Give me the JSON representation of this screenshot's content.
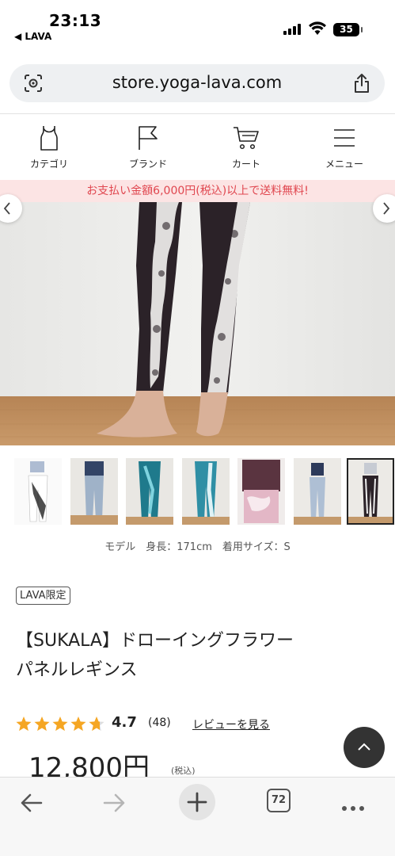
{
  "status": {
    "time": "23:13",
    "back_app": "◀ LAVA",
    "battery": "35"
  },
  "browser": {
    "url": "store.yoga-lava.com",
    "tab_count": "72"
  },
  "nav": {
    "items": [
      {
        "label": "カテゴリ",
        "icon": "tanktop-icon"
      },
      {
        "label": "ブランド",
        "icon": "flag-icon"
      },
      {
        "label": "カート",
        "icon": "cart-icon"
      },
      {
        "label": "メニュー",
        "icon": "hamburger-icon"
      }
    ]
  },
  "banner": "お支払い金額6,000円(税込)以上で送料無料!",
  "product": {
    "model_info": "モデル　身長：171cm　着用サイズ：S",
    "tag": "LAVA限定",
    "title_line1": "【SUKALA】ドローイングフラワー",
    "title_line2": "パネルレギンス",
    "rating": 4.7,
    "rating_text": "4.7",
    "review_count": "(48)",
    "review_link": "レビューを見る",
    "price": "12,800円",
    "tax_note": "(税込)"
  },
  "colors": {
    "banner_bg": "#fce4e4",
    "banner_text": "#e0464f",
    "star": "#f5a623",
    "leggings": "#2b2228"
  }
}
